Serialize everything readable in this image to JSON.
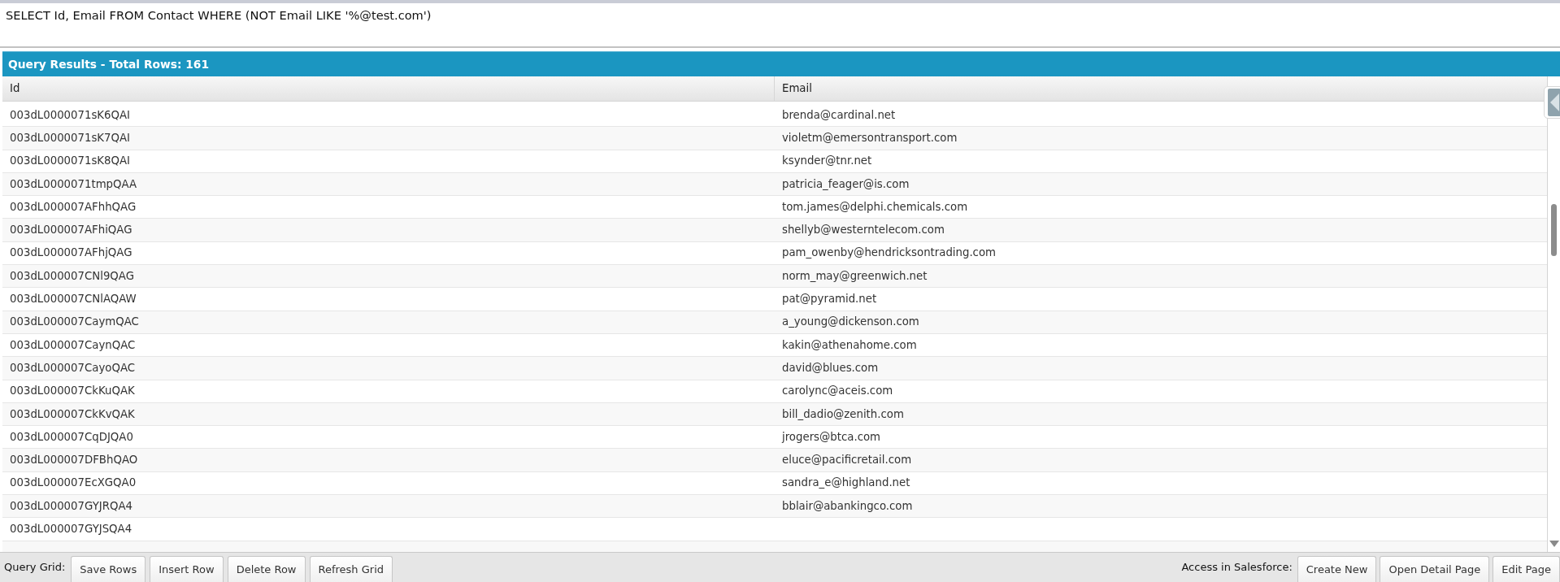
{
  "query_editor": {
    "value": "SELECT Id, Email FROM Contact WHERE (NOT Email LIKE '%@test.com')"
  },
  "results": {
    "title": "Query Results - Total Rows: 161",
    "columns": [
      "Id",
      "Email"
    ],
    "rows": [
      {
        "id": "003dL0000071sK6QAI",
        "email": "brenda@cardinal.net"
      },
      {
        "id": "003dL0000071sK7QAI",
        "email": "violetm@emersontransport.com"
      },
      {
        "id": "003dL0000071sK8QAI",
        "email": "ksynder@tnr.net"
      },
      {
        "id": "003dL0000071tmpQAA",
        "email": "patricia_feager@is.com"
      },
      {
        "id": "003dL000007AFhhQAG",
        "email": "tom.james@delphi.chemicals.com"
      },
      {
        "id": "003dL000007AFhiQAG",
        "email": "shellyb@westerntelecom.com"
      },
      {
        "id": "003dL000007AFhjQAG",
        "email": "pam_owenby@hendricksontrading.com"
      },
      {
        "id": "003dL000007CNl9QAG",
        "email": "norm_may@greenwich.net"
      },
      {
        "id": "003dL000007CNlAQAW",
        "email": "pat@pyramid.net"
      },
      {
        "id": "003dL000007CaymQAC",
        "email": "a_young@dickenson.com"
      },
      {
        "id": "003dL000007CaynQAC",
        "email": "kakin@athenahome.com"
      },
      {
        "id": "003dL000007CayoQAC",
        "email": "david@blues.com"
      },
      {
        "id": "003dL000007CkKuQAK",
        "email": "carolync@aceis.com"
      },
      {
        "id": "003dL000007CkKvQAK",
        "email": "bill_dadio@zenith.com"
      },
      {
        "id": "003dL000007CqDJQA0",
        "email": "jrogers@btca.com"
      },
      {
        "id": "003dL000007DFBhQAO",
        "email": "eluce@pacificretail.com"
      },
      {
        "id": "003dL000007EcXGQA0",
        "email": "sandra_e@highland.net"
      },
      {
        "id": "003dL000007GYJRQA4",
        "email": "bblair@abankingco.com"
      },
      {
        "id": "003dL000007GYJSQA4"
      }
    ]
  },
  "toolbar": {
    "grid_label": "Query Grid:",
    "grid_buttons": [
      "Save Rows",
      "Insert Row",
      "Delete Row",
      "Refresh Grid"
    ],
    "salesforce_label": "Access in Salesforce:",
    "salesforce_buttons": [
      "Create New",
      "Open Detail Page",
      "Edit Page"
    ]
  }
}
